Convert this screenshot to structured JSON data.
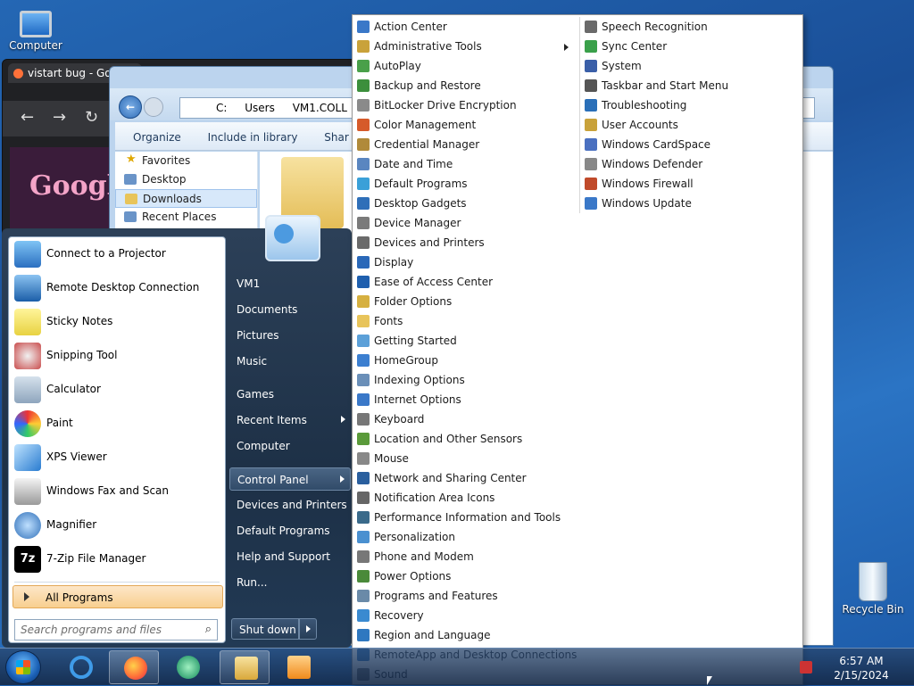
{
  "desktop": {
    "computer_label": "Computer",
    "recycle_label": "Recycle Bin"
  },
  "browser": {
    "tab_title": "vistart bug - Goog",
    "logo_text": "Google"
  },
  "explorer": {
    "path": [
      "C:",
      "Users",
      "VM1.COLL"
    ],
    "tools": [
      "Organize",
      "Include in library",
      "Shar"
    ],
    "nav": [
      "Favorites",
      "Desktop",
      "Downloads",
      "Recent Places"
    ]
  },
  "start_menu": {
    "programs": [
      "Connect to a Projector",
      "Remote Desktop Connection",
      "Sticky Notes",
      "Snipping Tool",
      "Calculator",
      "Paint",
      "XPS Viewer",
      "Windows Fax and Scan",
      "Magnifier",
      "7-Zip File Manager"
    ],
    "all_programs": "All Programs",
    "search_placeholder": "Search programs and files",
    "right": [
      "VM1",
      "Documents",
      "Pictures",
      "Music",
      "Games",
      "Recent Items",
      "Computer",
      "Control Panel",
      "Devices and Printers",
      "Default Programs",
      "Help and Support",
      "Run..."
    ],
    "shutdown": "Shut down"
  },
  "control_panel": {
    "col1": [
      "Action Center",
      "Administrative Tools",
      "AutoPlay",
      "Backup and Restore",
      "BitLocker Drive Encryption",
      "Color Management",
      "Credential Manager",
      "Date and Time",
      "Default Programs",
      "Desktop Gadgets",
      "Device Manager",
      "Devices and Printers",
      "Display",
      "Ease of Access Center",
      "Folder Options",
      "Fonts",
      "Getting Started",
      "HomeGroup",
      "Indexing Options",
      "Internet Options",
      "Keyboard",
      "Location and Other Sensors",
      "Mouse",
      "Network and Sharing Center",
      "Notification Area Icons",
      "Performance Information and Tools",
      "Personalization",
      "Phone and Modem",
      "Power Options",
      "Programs and Features",
      "Recovery",
      "Region and Language",
      "RemoteApp and Desktop Connections",
      "Sound"
    ],
    "col2": [
      "Speech Recognition",
      "Sync Center",
      "System",
      "Taskbar and Start Menu",
      "Troubleshooting",
      "User Accounts",
      "Windows CardSpace",
      "Windows Defender",
      "Windows Firewall",
      "Windows Update"
    ]
  },
  "taskbar": {
    "time": "6:57 AM",
    "date": "2/15/2024"
  },
  "colors": {
    "accent": "#2467b4",
    "menu_highlight": "#f8cf8f"
  }
}
